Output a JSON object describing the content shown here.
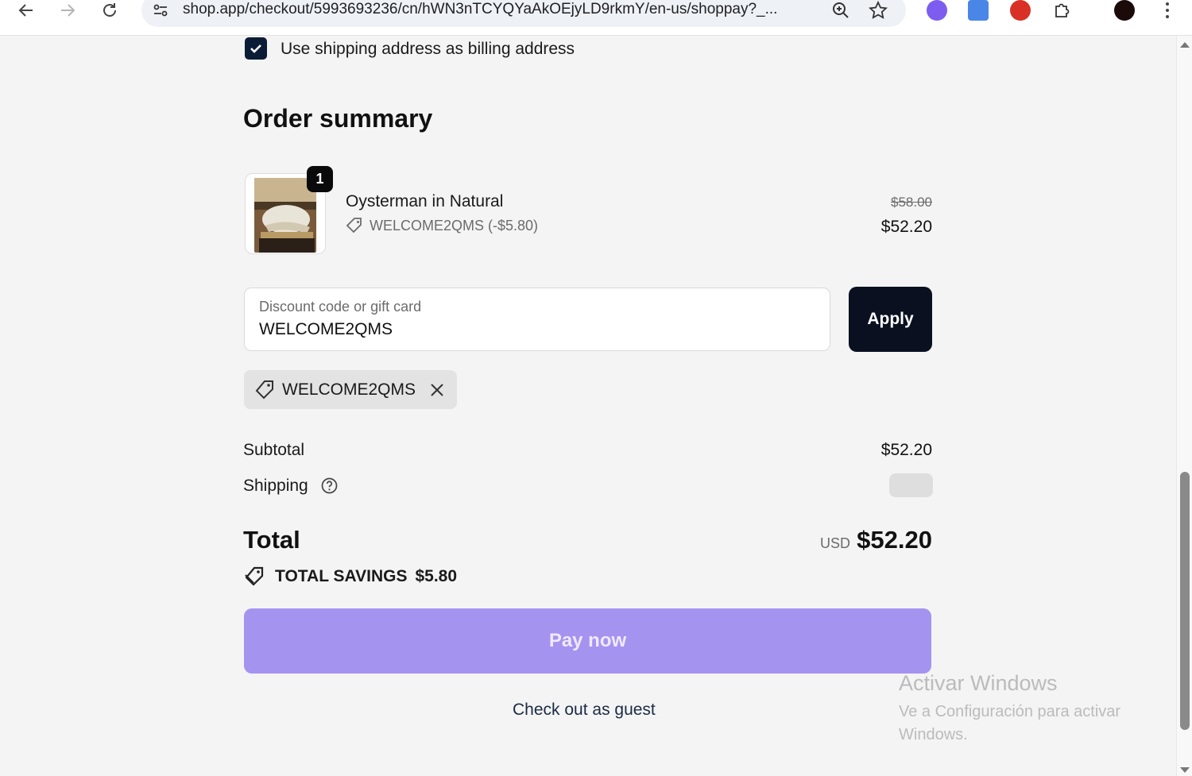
{
  "browser": {
    "url": "shop.app/checkout/5993693236/cn/hWN3nTCYQYaAkOEjyLD9rkmY/en-us/shoppay?_...",
    "icons": [
      "back-icon",
      "forward-icon",
      "reload-icon",
      "site-settings-icon",
      "zoom-icon",
      "bookmark-star-icon",
      "extension-icon",
      "google-translate-icon",
      "extension-bug-icon",
      "extensions-puzzle-icon",
      "profile-avatar",
      "menu-kebab-icon"
    ]
  },
  "billing": {
    "checkbox_checked": true,
    "checkbox_label": "Use shipping address as billing address"
  },
  "order_summary": {
    "title": "Order summary",
    "item": {
      "quantity": "1",
      "name": "Oysterman in Natural",
      "discount": "WELCOME2QMS (-$5.80)",
      "original_price": "$58.00",
      "price": "$52.20"
    }
  },
  "discount": {
    "placeholder": "Discount code or gift card",
    "value": "WELCOME2QMS",
    "apply_label": "Apply",
    "applied_code": "WELCOME2QMS"
  },
  "totals": {
    "subtotal_label": "Subtotal",
    "subtotal_value": "$52.20",
    "shipping_label": "Shipping",
    "total_label": "Total",
    "currency": "USD",
    "total_value": "$52.20",
    "savings_label": "TOTAL SAVINGS",
    "savings_value": "$5.80"
  },
  "actions": {
    "pay_label": "Pay now",
    "guest_label": "Check out as guest"
  },
  "watermark": {
    "title": "Activar Windows",
    "subtitle": "Ve a Configuración para activar Windows."
  },
  "colors": {
    "pay_button": "#a593f0",
    "apply_button": "#0a1020",
    "checkbox": "#0b1d36"
  }
}
